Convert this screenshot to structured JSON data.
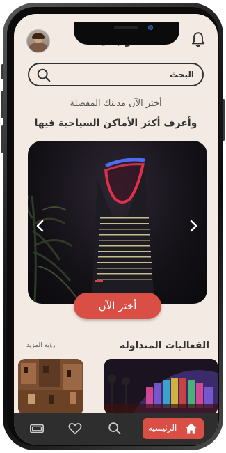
{
  "header": {
    "title": "الرئيسية",
    "avatar_icon": "user-avatar",
    "bell_icon": "bell-icon"
  },
  "search": {
    "label": "البحث",
    "icon": "search-icon"
  },
  "intro": {
    "line1": "أختر الآن مدينك المفضلة",
    "line2": "وأعرف أكثر الأماكن السياحية فيها"
  },
  "hero": {
    "prev_icon": "chevron-left-icon",
    "next_icon": "chevron-right-icon",
    "cta_label": "أختر الآن"
  },
  "trending": {
    "title": "الفعاليات المتداولة",
    "see_more": "رؤية المزيد"
  },
  "bottom_nav": {
    "items": [
      {
        "icon": "ticket-icon"
      },
      {
        "icon": "heart-icon"
      },
      {
        "icon": "search-icon"
      },
      {
        "icon": "home-icon",
        "label": "الرئيسية",
        "active": true
      }
    ]
  },
  "colors": {
    "accent": "#d94f45",
    "background": "#f3ebe3",
    "nav_background": "#2e2e2e"
  }
}
